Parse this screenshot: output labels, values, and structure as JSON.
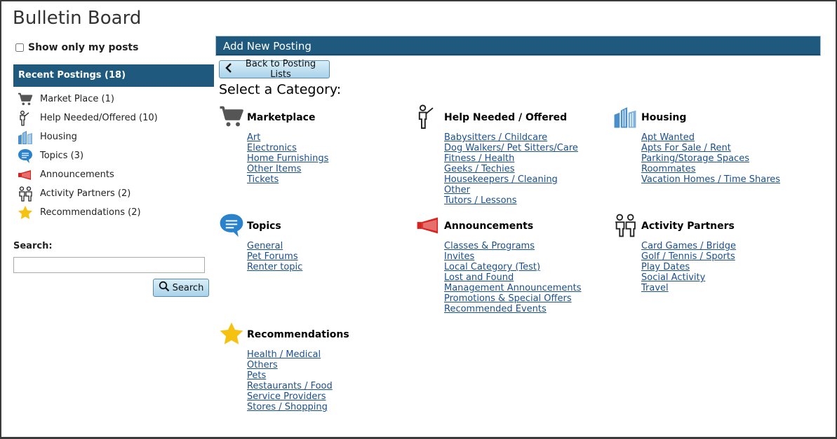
{
  "page": {
    "title": "Bulletin Board"
  },
  "filters": {
    "show_mine_label": "Show only my posts"
  },
  "recent": {
    "header": "Recent Postings (18)",
    "items": [
      {
        "label": "Market Place (1)",
        "icon": "cart-icon"
      },
      {
        "label": "Help Needed/Offered (10)",
        "icon": "helper-person-icon"
      },
      {
        "label": "Housing",
        "icon": "buildings-icon"
      },
      {
        "label": "Topics (3)",
        "icon": "speech-bubble-icon"
      },
      {
        "label": "Announcements",
        "icon": "megaphone-icon"
      },
      {
        "label": "Activity Partners (2)",
        "icon": "two-people-icon"
      },
      {
        "label": "Recommendations (2)",
        "icon": "star-icon"
      }
    ]
  },
  "search": {
    "label": "Search:",
    "value": "",
    "placeholder": "",
    "button_label": "Search"
  },
  "main": {
    "header": "Add New Posting",
    "back_label": "Back to Posting Lists",
    "select_title": "Select a Category:",
    "categories": [
      {
        "title": "Marketplace",
        "icon": "cart-icon",
        "links": [
          "Art",
          "Electronics",
          "Home Furnishings",
          "Other Items",
          "Tickets"
        ]
      },
      {
        "title": "Help Needed / Offered",
        "icon": "helper-person-icon",
        "links": [
          "Babysitters / Childcare",
          "Dog Walkers/ Pet Sitters/Care",
          "Fitness / Health",
          "Geeks / Techies",
          "Housekeepers / Cleaning",
          "Other",
          "Tutors / Lessons"
        ]
      },
      {
        "title": "Housing",
        "icon": "buildings-icon",
        "links": [
          "Apt Wanted",
          "Apts For Sale / Rent",
          "Parking/Storage Spaces",
          "Roommates",
          "Vacation Homes / Time Shares"
        ]
      },
      {
        "title": "Topics",
        "icon": "speech-bubble-icon",
        "links": [
          "General",
          "Pet Forums",
          "Renter topic"
        ]
      },
      {
        "title": "Announcements",
        "icon": "megaphone-icon",
        "links": [
          "Classes & Programs",
          "Invites",
          "Local Category (Test)",
          "Lost and Found",
          "Management Announcements",
          "Promotions & Special Offers",
          "Recommended Events"
        ]
      },
      {
        "title": "Activity Partners",
        "icon": "two-people-icon",
        "links": [
          "Card Games / Bridge",
          "Golf / Tennis / Sports",
          "Play Dates",
          "Social Activity",
          "Travel"
        ]
      },
      {
        "title": "Recommendations",
        "icon": "star-icon",
        "links": [
          "Health / Medical",
          "Others",
          "Pets",
          "Restaurants / Food",
          "Service Providers",
          "Stores / Shopping"
        ]
      }
    ]
  },
  "colors": {
    "header_bg": "#1f5a7e",
    "link": "#1a4f8f",
    "button_bg": "#a9d3e9",
    "megaphone": "#d9231f",
    "star": "#f5c211",
    "buildings": "#4a8fc9"
  }
}
